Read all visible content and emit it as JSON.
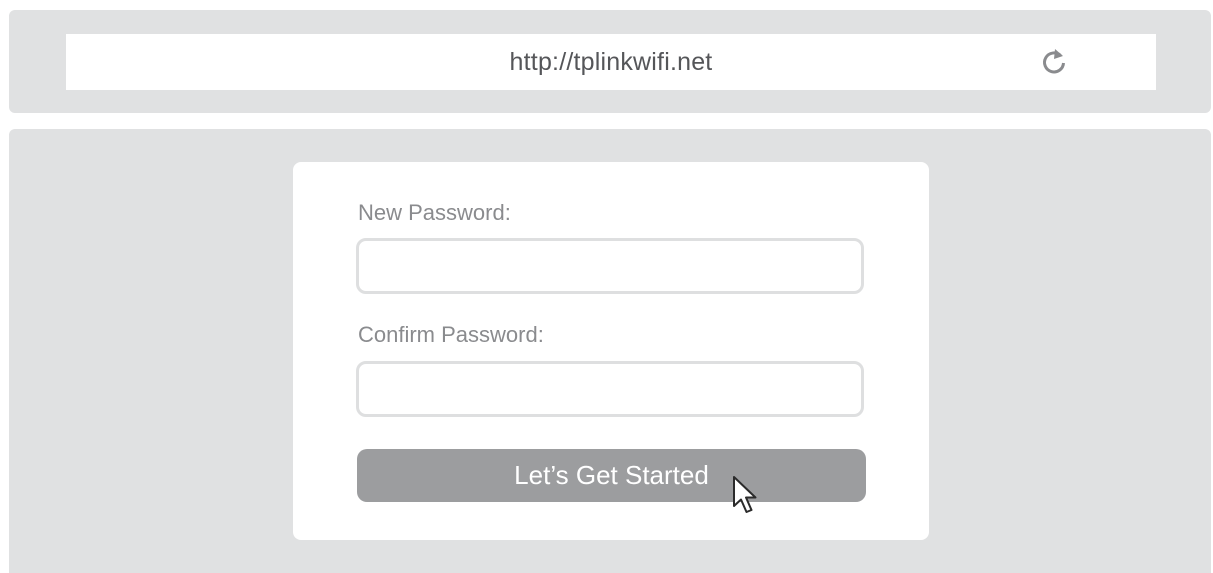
{
  "browser": {
    "url": "http://tplinkwifi.net",
    "refresh_icon": "refresh-icon"
  },
  "form": {
    "new_password_label": "New Password:",
    "new_password_value": "",
    "confirm_password_label": "Confirm Password:",
    "confirm_password_value": "",
    "submit_label": "Let’s Get Started"
  },
  "pointer_icon": "mouse-pointer-icon",
  "colors": {
    "chrome_gray": "#e0e1e2",
    "button_gray": "#9c9d9f",
    "label_gray": "#8a8b8e",
    "input_border": "#dedfe0"
  }
}
